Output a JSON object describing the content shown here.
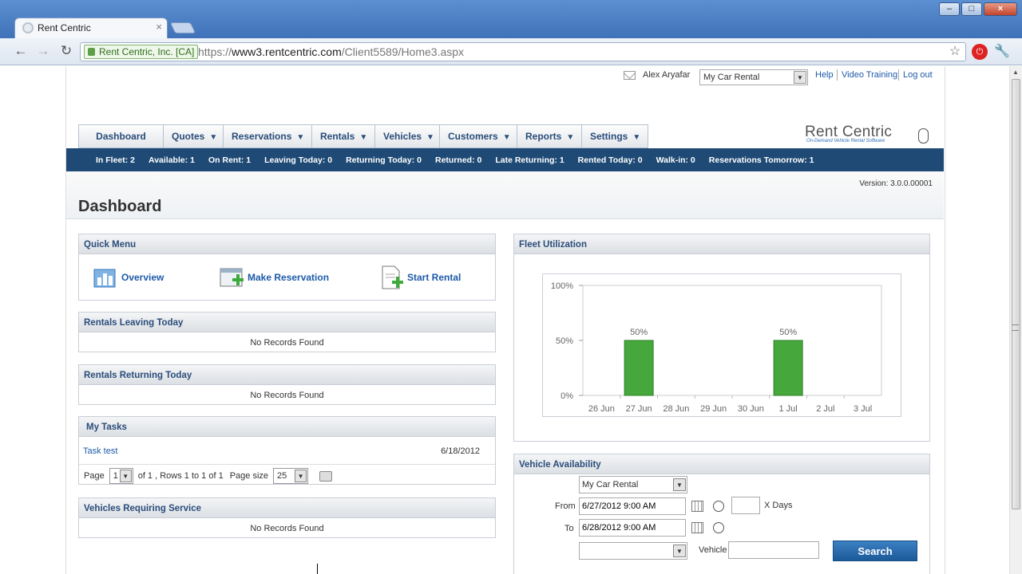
{
  "browser": {
    "tab_title": "Rent Centric",
    "ev_label": "Rent Centric, Inc. [CA]",
    "url_scheme": "https://",
    "url_host": "www3.rentcentric.com",
    "url_path": "/Client5589/Home3.aspx"
  },
  "header": {
    "user_name": "Alex Aryafar",
    "location_select": "My Car Rental",
    "links": [
      "Help",
      "Video Training",
      "Log out"
    ]
  },
  "nav": {
    "items": [
      {
        "label": "Dashboard",
        "has_caret": false
      },
      {
        "label": "Quotes",
        "has_caret": true
      },
      {
        "label": "Reservations",
        "has_caret": true
      },
      {
        "label": "Rentals",
        "has_caret": true
      },
      {
        "label": "Vehicles",
        "has_caret": true
      },
      {
        "label": "Customers",
        "has_caret": true
      },
      {
        "label": "Reports",
        "has_caret": true
      },
      {
        "label": "Settings",
        "has_caret": true
      }
    ],
    "logo_text": "Rent Centric",
    "logo_tagline": "On-Demand Vehicle Rental Software"
  },
  "status": [
    "In Fleet: 2",
    "Available: 1",
    "On Rent: 1",
    "Leaving Today: 0",
    "Returning Today: 0",
    "Returned: 0",
    "Late Returning: 1",
    "Rented Today: 0",
    "Walk-in: 0",
    "Reservations Tomorrow: 1"
  ],
  "version": "Version: 3.0.0.00001",
  "page_title": "Dashboard",
  "quick_menu": {
    "title": "Quick Menu",
    "items": [
      "Overview",
      "Make Reservation",
      "Start Rental"
    ]
  },
  "rentals_leaving": {
    "title": "Rentals Leaving Today",
    "empty": "No Records Found"
  },
  "rentals_returning": {
    "title": "Rentals Returning Today",
    "empty": "No Records Found"
  },
  "my_tasks": {
    "title": "My Tasks",
    "task_name": "Task test",
    "task_date": "6/18/2012",
    "page_label": "Page",
    "page_value": "1",
    "page_info": "of 1 , Rows 1 to 1 of 1",
    "size_label": "Page size",
    "size_value": "25"
  },
  "vehicles_service": {
    "title": "Vehicles Requiring Service",
    "empty": "No Records Found"
  },
  "fleet": {
    "title": "Fleet Utilization"
  },
  "chart_data": {
    "type": "bar",
    "categories": [
      "26 Jun",
      "27 Jun",
      "28 Jun",
      "29 Jun",
      "30 Jun",
      "1 Jul",
      "2 Jul",
      "3 Jul"
    ],
    "values": [
      0,
      50,
      0,
      0,
      0,
      50,
      0,
      0
    ],
    "data_labels": [
      "",
      "50%",
      "",
      "",
      "",
      "50%",
      "",
      ""
    ],
    "y_ticks": [
      "100%",
      "50%",
      "0%"
    ],
    "ylim": [
      0,
      100
    ],
    "color": "#46a83c",
    "grid": false
  },
  "availability": {
    "title": "Vehicle Availability",
    "location": "My Car Rental",
    "from_label": "From",
    "from_value": "6/27/2012 9:00 AM",
    "to_label": "To",
    "to_value": "6/28/2012 9:00 AM",
    "days_value": "",
    "days_label": "X Days",
    "vehicle_type": "",
    "vehicle_label": "Vehicle",
    "vehicle_value": "",
    "search_label": "Search"
  }
}
